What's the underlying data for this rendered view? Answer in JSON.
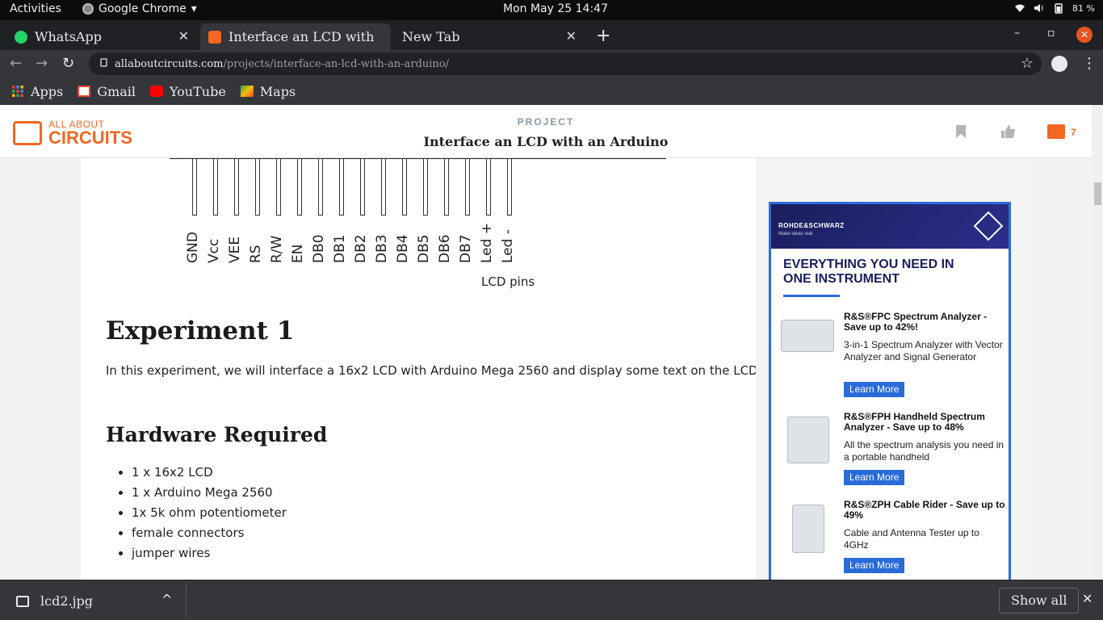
{
  "system": {
    "activities": "Activities",
    "app_name": "Google Chrome",
    "app_menu_arrow": "▾",
    "clock": "Mon May 25  14:47",
    "battery": "81 %"
  },
  "tabs": [
    {
      "label": "WhatsApp",
      "close": "✕"
    },
    {
      "label": "Interface an LCD with a",
      "close": "✕"
    },
    {
      "label": "New Tab",
      "close": "✕"
    }
  ],
  "window": {
    "new_tab": "+",
    "minimize": "–",
    "maximize": "▫",
    "close": "✕"
  },
  "nav": {
    "back": "←",
    "forward": "→",
    "reload": "↻",
    "star": "☆",
    "menu": "⋮"
  },
  "address": {
    "host": "allaboutcircuits.com",
    "path": "/projects/interface-an-lcd-with-an-arduino/"
  },
  "bookmarks": [
    {
      "label": "Apps"
    },
    {
      "label": "Gmail"
    },
    {
      "label": "YouTube"
    },
    {
      "label": "Maps"
    }
  ],
  "site": {
    "logo_line1": "ALL ABOUT",
    "logo_line2": "CIRCUITS",
    "project_label": "PROJECT",
    "project_title": "Interface an LCD with an Arduino",
    "comment_count": "7"
  },
  "diagram": {
    "pins": [
      "GND",
      "Vcc",
      "VEE",
      "RS",
      "R/W",
      "EN",
      "DB0",
      "DB1",
      "DB2",
      "DB3",
      "DB4",
      "DB5",
      "DB6",
      "DB7",
      "Led +",
      "Led -"
    ],
    "caption": "LCD pins"
  },
  "article": {
    "experiment_heading": "Experiment 1",
    "experiment_text": "In this experiment, we will interface a 16x2 LCD with Arduino Mega 2560 and display some text on the LCD.",
    "hardware_heading": "Hardware Required",
    "hardware_items": [
      "1 x 16x2 LCD",
      "1 x Arduino Mega 2560",
      "1x 5k ohm potentiometer",
      "female connectors",
      "jumper wires"
    ]
  },
  "ad": {
    "brand": "ROHDE&SCHWARZ",
    "tagline": "Make ideas real",
    "headline": "EVERYTHING YOU NEED IN ONE INSTRUMENT",
    "items": [
      {
        "title": "R&S®FPC Spectrum Analyzer - Save up to 42%!",
        "desc": "3-in-1 Spectrum Analyzer with Vector Analyzer and Signal Generator",
        "cta": "Learn More"
      },
      {
        "title": "R&S®FPH Handheld Spectrum Analyzer - Save up to 48%",
        "desc": "All the spectrum analysis you need in a portable handheld",
        "cta": "Learn More"
      },
      {
        "title": "R&S®ZPH Cable Rider - Save up to 49%",
        "desc": "Cable and Antenna Tester up to 4GHz",
        "cta": "Learn More"
      }
    ]
  },
  "downloads": {
    "file": "lcd2.jpg",
    "chevron": "^",
    "show_all": "Show all",
    "close": "✕"
  },
  "colors": {
    "accent": "#f26722",
    "ad_blue": "#2a6bd8",
    "ubuntu_orange": "#e95420"
  }
}
